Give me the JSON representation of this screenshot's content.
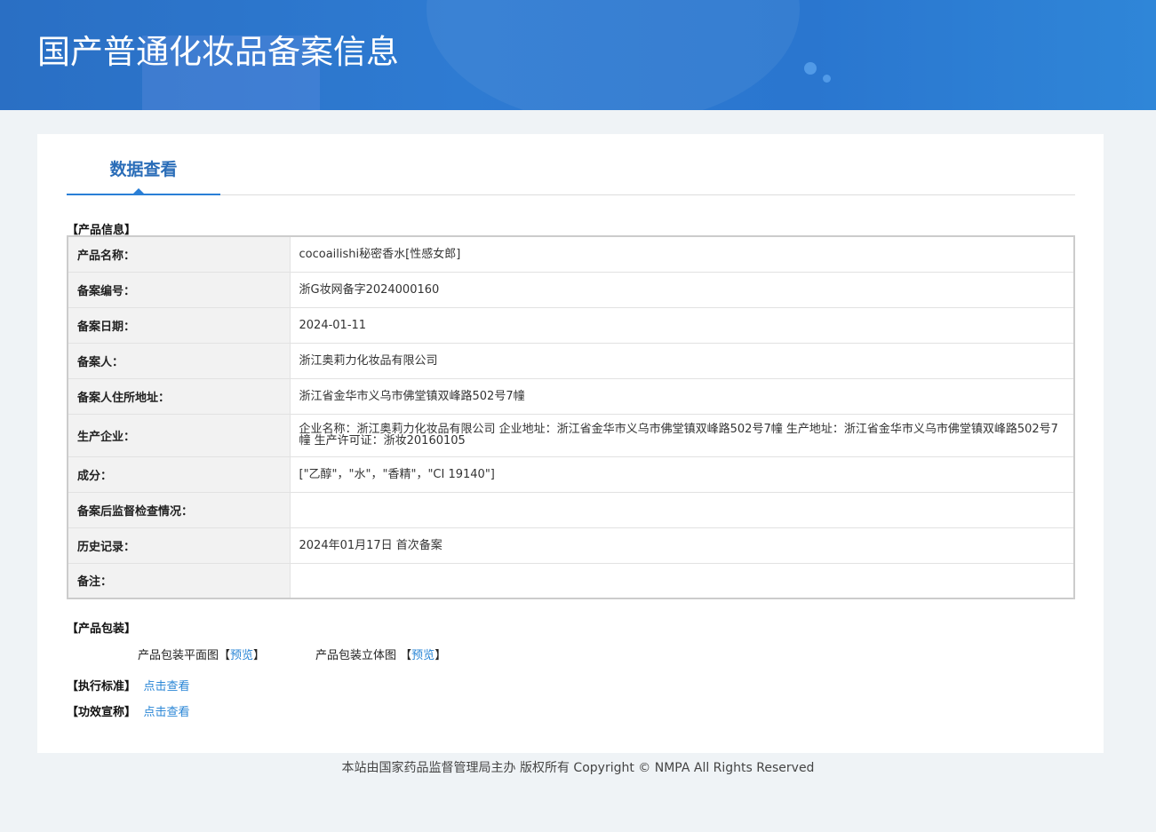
{
  "header": {
    "title": "国产普通化妆品备案信息"
  },
  "tab": {
    "label": "数据查看"
  },
  "product_info": {
    "section_label": "【产品信息】",
    "rows": [
      {
        "label": "产品名称：",
        "value": "cocoailishi秘密香水[性感女郎]"
      },
      {
        "label": "备案编号：",
        "value": "浙G妆网备字2024000160"
      },
      {
        "label": "备案日期：",
        "value": "2024-01-11"
      },
      {
        "label": "备案人：",
        "value": "浙江奥莉力化妆品有限公司"
      },
      {
        "label": "备案人住所地址：",
        "value": "浙江省金华市义乌市佛堂镇双峰路502号7幢"
      },
      {
        "label": "生产企业：",
        "value": "企业名称：浙江奥莉力化妆品有限公司 企业地址：浙江省金华市义乌市佛堂镇双峰路502号7幢 生产地址：浙江省金华市义乌市佛堂镇双峰路502号7幢 生产许可证：浙妆20160105"
      },
      {
        "label": "成分：",
        "value": "[\"乙醇\"，\"水\"，\"香精\"，\"CI 19140\"]"
      },
      {
        "label": "备案后监督检查情况：",
        "value": ""
      },
      {
        "label": "历史记录：",
        "value": "2024年01月17日 首次备案"
      },
      {
        "label": "备注：",
        "value": ""
      }
    ]
  },
  "packaging": {
    "section_label": "【产品包装】",
    "flat_label": "产品包装平面图",
    "solid_label": "产品包装立体图",
    "bracket_open": "【",
    "bracket_close": "】",
    "preview": "预览"
  },
  "standard": {
    "section_label": "【执行标准】",
    "link": "点击查看"
  },
  "efficacy": {
    "section_label": "【功效宣称】",
    "link": "点击查看"
  },
  "footer": {
    "text": "本站由国家药品监督管理局主办 版权所有 Copyright © NMPA All Rights Reserved"
  }
}
